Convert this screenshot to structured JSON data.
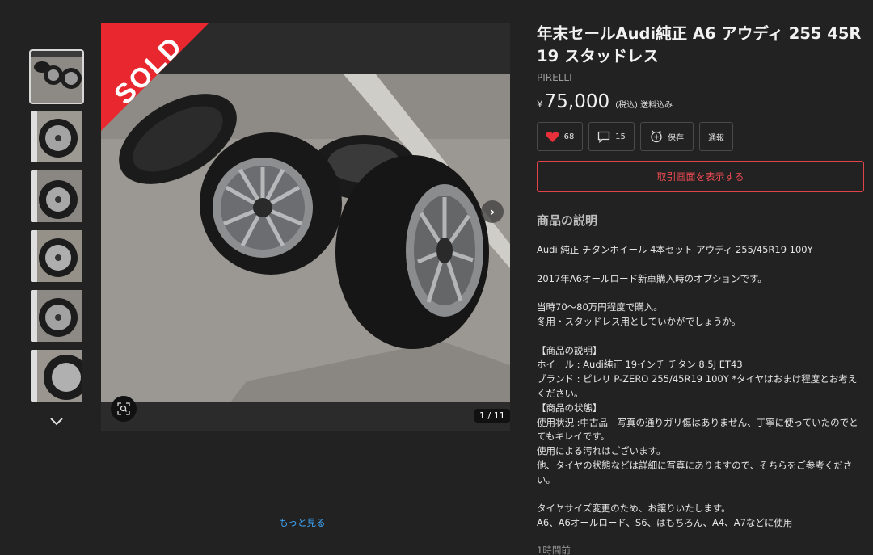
{
  "listing": {
    "title": "年末セールAudi純正 A6 アウディ 255 45R 19 スタッドレス",
    "brand": "PIRELLI",
    "currency": "¥",
    "price": "75,000",
    "tax_note": "(税込) 送料込み",
    "status_badge": "SOLD"
  },
  "actions": {
    "like_count": "68",
    "comment_count": "15",
    "save_label": "保存",
    "report_label": "通報",
    "trade_button": "取引画面を表示する"
  },
  "viewer": {
    "counter": "1 / 11"
  },
  "description": {
    "heading": "商品の説明",
    "body": "Audi 純正 チタンホイール 4本セット アウディ 255/45R19 100Y\n\n2017年A6オールロード新車購入時のオプションです。\n\n当時70〜80万円程度で購入。\n冬用・スタッドレス用としていかがでしょうか。\n\n【商品の説明】\nホイール : Audi純正 19インチ チタン 8.5J ET43\nブランド : ピレリ P-ZERO 255/45R19 100Y *タイヤはおまけ程度とお考えください。\n【商品の状態】\n使用状況 :中古品　写真の通りガリ傷はありません、丁寧に使っていたのでとてもキレイです。\n使用による汚れはございます。\n他、タイヤの状態などは詳細に写真にありますので、そちらをご参考ください。\n\nタイヤサイズ変更のため、お譲りいたします。\nA6、A6オールロード、S6、はもちろん、A4、A7などに使用",
    "more_link": "もっと見る",
    "posted": "1時間前"
  },
  "colors": {
    "accent_red": "#e8282e",
    "link_blue": "#3ea5f5",
    "background": "#222222"
  },
  "icons": [
    "heart-icon",
    "comment-icon",
    "save-icon",
    "zoom-icon",
    "chevron-right-icon",
    "chevron-down-icon"
  ]
}
